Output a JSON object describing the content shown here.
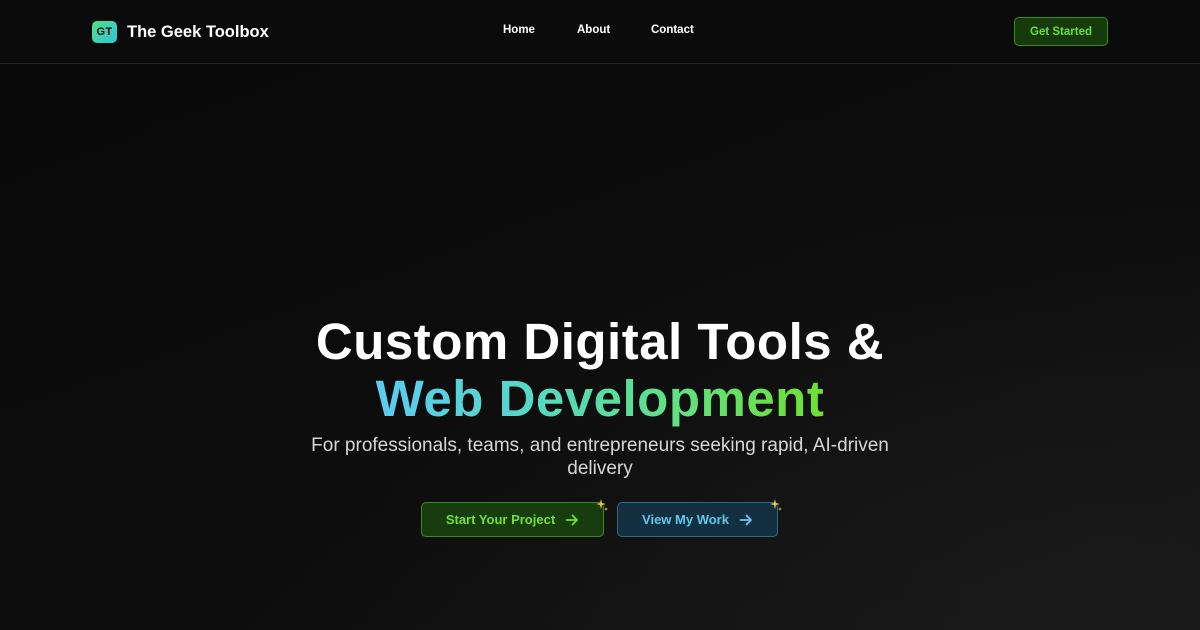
{
  "header": {
    "logo_initials": "GT",
    "brand_name": "The Geek Toolbox",
    "nav": {
      "home": "Home",
      "about": "About",
      "contact": "Contact"
    },
    "cta_label": "Get Started"
  },
  "hero": {
    "title_line1": "Custom Digital Tools &",
    "title_line2": "Web Development",
    "subtitle": "For professionals, teams, and entrepreneurs seeking rapid, AI-driven delivery",
    "primary_button": "Start Your Project",
    "secondary_button": "View My Work"
  },
  "icons": {
    "arrow": "arrow-right-icon",
    "sparkle": "sparkle-icon"
  },
  "colors": {
    "background": "#0b0b0b",
    "accent_green": "#6ee235",
    "accent_blue": "#5fc8ef",
    "logo_gradient_start": "#4ee08a",
    "logo_gradient_end": "#2fc6d6"
  }
}
